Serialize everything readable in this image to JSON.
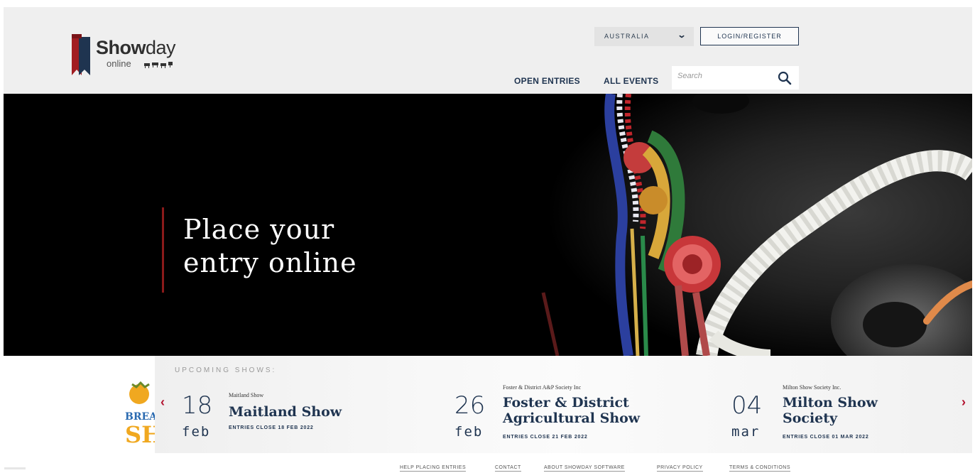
{
  "brand": {
    "name_bold": "Show",
    "name_light": "day",
    "subtitle": "online"
  },
  "header": {
    "country": "AUSTRALIA",
    "login_label": "LOGIN/REGISTER",
    "nav": [
      "OPEN ENTRIES",
      "ALL EVENTS"
    ],
    "search_placeholder": "Search"
  },
  "hero": {
    "title_line1": "Place your",
    "title_line2": "entry online"
  },
  "upcoming": {
    "heading": "UPCOMING SHOWS:",
    "shows": [
      {
        "day": "18",
        "month": "feb",
        "organiser": "Maitland Show",
        "name_line1": "Maitland Show",
        "name_line2": "",
        "closes": "ENTRIES CLOSE 18 FEB 2022"
      },
      {
        "day": "26",
        "month": "feb",
        "organiser": "Foster & District A&P Society Inc",
        "name_line1": "Foster & District",
        "name_line2": "Agricultural Show",
        "closes": "ENTRIES CLOSE 21 FEB 2022"
      },
      {
        "day": "04",
        "month": "mar",
        "organiser": "Milton Show Society Inc.",
        "name_line1": "Milton Show",
        "name_line2": "Society",
        "closes": "ENTRIES CLOSE 01 MAR 2022"
      }
    ]
  },
  "promo": {
    "text_top": "BREA",
    "text_bottom": "SH"
  },
  "footer": {
    "links": [
      "HELP PLACING ENTRIES",
      "CONTACT",
      "ABOUT SHOWDAY SOFTWARE",
      "PRIVACY POLICY",
      "TERMS & CONDITIONS"
    ]
  },
  "colors": {
    "navy": "#1f3450",
    "accent_red": "#b3122f",
    "header_bg": "#efefef"
  }
}
